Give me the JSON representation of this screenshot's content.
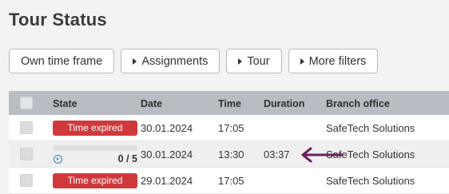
{
  "page": {
    "title": "Tour Status"
  },
  "toolbar": {
    "own_time_frame": "Own time frame",
    "assignments": "Assignments",
    "tour": "Tour",
    "more_filters": "More filters"
  },
  "table": {
    "headers": {
      "state": "State",
      "date": "Date",
      "time": "Time",
      "duration": "Duration",
      "branch": "Branch office"
    },
    "rows": [
      {
        "state": "Time expired",
        "date": "30.01.2024",
        "time": "17:05",
        "duration": "",
        "branch": "SafeTech Solutions"
      },
      {
        "state": "",
        "progress_text": "0 / 5",
        "progress_fraction": 0,
        "date": "30.01.2024",
        "time": "13:30",
        "duration": "03:37",
        "branch": "SafeTech Solutions"
      },
      {
        "state": "Time expired",
        "date": "29.01.2024",
        "time": "17:05",
        "duration": "",
        "branch": "SafeTech Solutions"
      }
    ]
  },
  "colors": {
    "expired_badge": "#d0393c",
    "header_bg": "#b8bdc4",
    "annotation_arrow": "#6b1f5e",
    "play_icon": "#3d7fc0"
  },
  "icons": {
    "filter_toggle": "triangle-right-icon",
    "play": "play-circle-icon",
    "annotation": "arrow-left-icon"
  }
}
